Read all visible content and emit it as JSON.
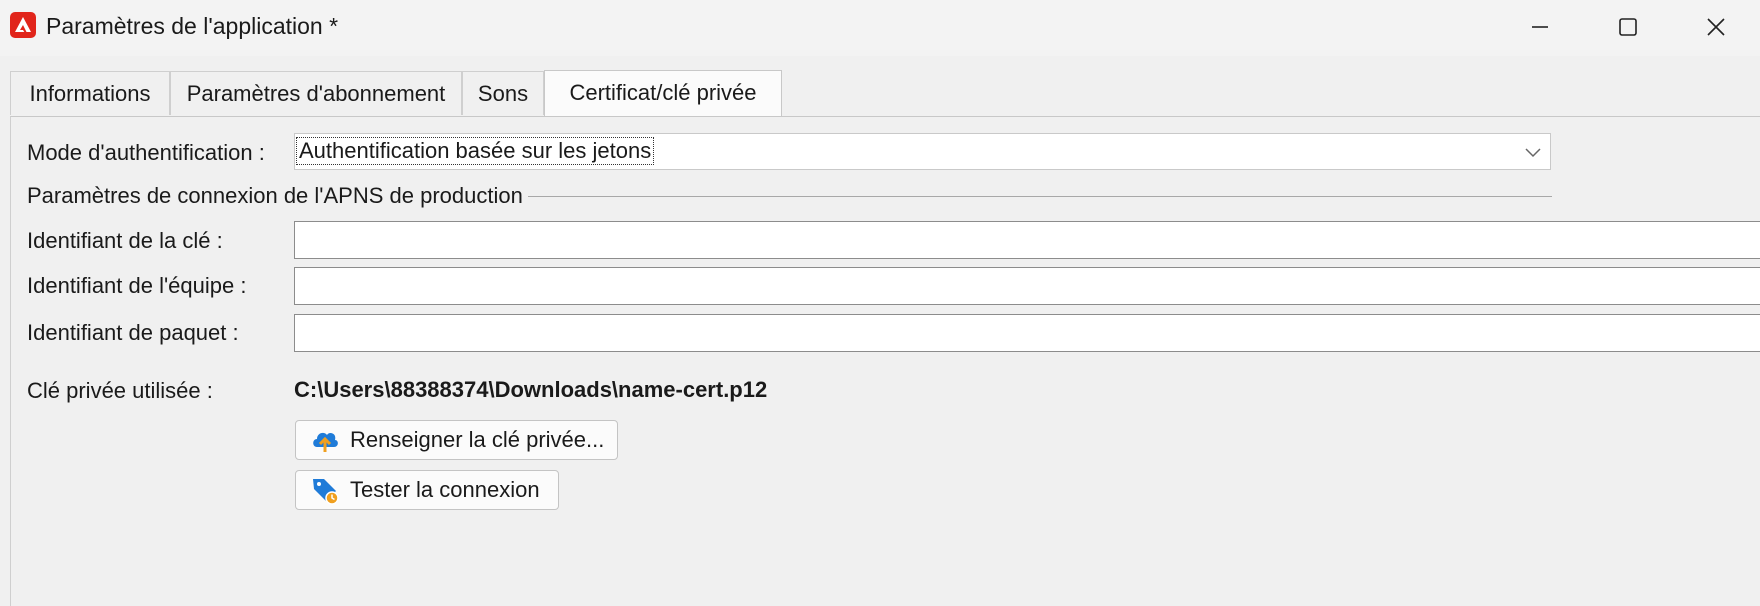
{
  "window": {
    "title": "Paramètres de l'application *",
    "app_icon": "adobe-campaign-icon",
    "controls": [
      "minimize-icon",
      "maximize-icon",
      "close-icon"
    ]
  },
  "tabs": [
    {
      "label": "Informations",
      "active": false
    },
    {
      "label": "Paramètres d'abonnement",
      "active": false
    },
    {
      "label": "Sons",
      "active": false
    },
    {
      "label": "Certificat/clé privée",
      "active": true
    }
  ],
  "auth": {
    "label": "Mode d'authentification :",
    "value": "Authentification basée sur les jetons"
  },
  "group": {
    "title": "Paramètres de connexion de l'APNS de production"
  },
  "fields": {
    "key_id": {
      "label": "Identifiant de la clé :",
      "value": ""
    },
    "team_id": {
      "label": "Identifiant de l'équipe :",
      "value": ""
    },
    "bundle_id": {
      "label": "Identifiant de paquet :",
      "value": ""
    }
  },
  "private_key": {
    "label": "Clé privée utilisée :",
    "path": "C:\\Users\\88388374\\Downloads\\name-cert.p12"
  },
  "buttons": {
    "fill_key": {
      "label": "Renseigner la clé privée...",
      "icon": "cloud-upload-icon"
    },
    "test_connection": {
      "label": "Tester la connexion",
      "icon": "tag-test-icon"
    }
  },
  "colors": {
    "brand": "#e1251b",
    "accent_blue": "#1f7bd8",
    "accent_orange": "#f0a020"
  }
}
